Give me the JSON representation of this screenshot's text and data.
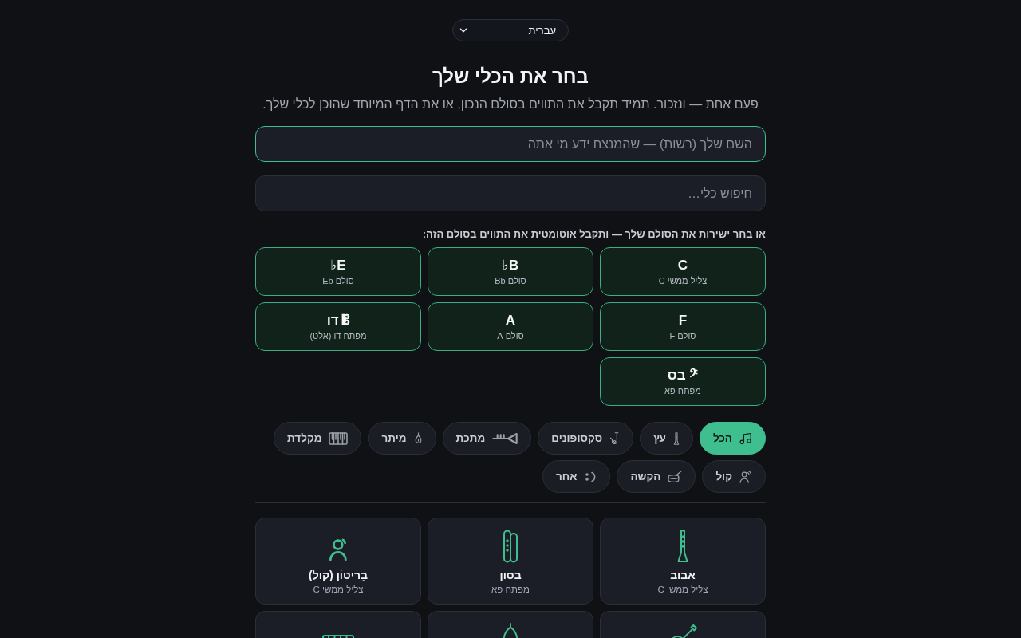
{
  "language_select": {
    "value": "עברית"
  },
  "title": "בחר את הכלי שלך",
  "subtitle": "פעם אחת — ונזכור. תמיד תקבל את התווים בסולם הנכון, או את הדף המיוחד שהוכן לכלי שלך.",
  "name_field": {
    "placeholder": "השם שלך (רשות) — שהמנצח ידע מי אתה",
    "focused": true
  },
  "search_field": {
    "placeholder": "חיפוש כלי…",
    "focused": false
  },
  "key_prompt": "או בחר ישירות את הסולם שלך — ותקבל אוטומטית את התווים בסולם הזה:",
  "keys": [
    {
      "label": "C",
      "caption": "צליל ממשי C"
    },
    {
      "label": "B♭",
      "caption": "סולם Bb"
    },
    {
      "label": "E♭",
      "caption": "סולם Eb"
    },
    {
      "label": "F",
      "caption": "סולם F"
    },
    {
      "label": "A",
      "caption": "סולם A"
    },
    {
      "label": "𝄡 דו",
      "caption": "מפתח דו (אלט)"
    },
    {
      "label": "𝄢 בס",
      "caption": "מפתח פא"
    }
  ],
  "categories": [
    {
      "label": "הכל",
      "kind": "all",
      "selected": true
    },
    {
      "label": "עץ",
      "kind": "woodwind",
      "selected": false
    },
    {
      "label": "סקסופונים",
      "kind": "saxophone",
      "selected": false
    },
    {
      "label": "מתכת",
      "kind": "brass",
      "selected": false
    },
    {
      "label": "מיתר",
      "kind": "strings",
      "selected": false
    },
    {
      "label": "מקלדת",
      "kind": "keyboard",
      "selected": false
    },
    {
      "label": "קול",
      "kind": "voice",
      "selected": false
    },
    {
      "label": "הקשה",
      "kind": "percussion",
      "selected": false
    },
    {
      "label": "אחר",
      "kind": "other",
      "selected": false
    }
  ],
  "instruments": [
    {
      "name": "אבוב",
      "caption": "צליל ממשי C",
      "kind": "oboe"
    },
    {
      "name": "בסון",
      "caption": "מפתח פא",
      "kind": "bassoon"
    },
    {
      "name": "בָריטוֹן (קול)",
      "caption": "צליל ממשי C",
      "kind": "voice"
    },
    {
      "kind": "guitar"
    },
    {
      "kind": "bell"
    },
    {
      "kind": "keyboard"
    }
  ]
}
